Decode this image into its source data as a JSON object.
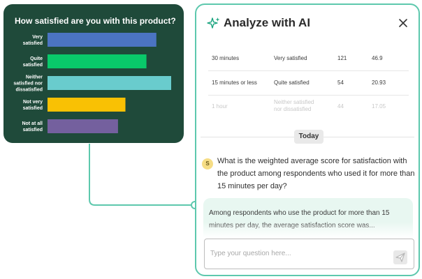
{
  "chart_card": {
    "background": "#1f4a3a",
    "title": "How satisfied are you with this product?"
  },
  "chart_data": {
    "type": "bar",
    "orientation": "horizontal",
    "title": "How satisfied are you with this product?",
    "categories": [
      "Very satisfied",
      "Quite satisfied",
      "Neither satisfied nor dissatisfied",
      "Not very satisfied",
      "Not at all satisfied"
    ],
    "category_lines": [
      [
        "Very",
        "satisfied"
      ],
      [
        "Quite",
        "satisfied"
      ],
      [
        "Neither",
        "satisfied nor",
        "dissatisfied"
      ],
      [
        "Not very",
        "satisfied"
      ],
      [
        "Not at all",
        "satisfied"
      ]
    ],
    "values": [
      88,
      80,
      100,
      63,
      57
    ],
    "colors": [
      "#4b74c2",
      "#09c96a",
      "#69cccd",
      "#f9c104",
      "#74609e"
    ],
    "xlim": [
      0,
      100
    ],
    "grid": false,
    "legend": "none"
  },
  "ai_panel": {
    "title": "Analyze with AI",
    "border_color": "#5dc8ad",
    "close_icon": "close-icon",
    "sparkle_icon": "sparkle-icon",
    "table_rows": [
      {
        "duration": "30 minutes",
        "satisfaction": "Very satisfied",
        "count": "121",
        "percent": "46.9"
      },
      {
        "duration": "15 minutes or less",
        "satisfaction": "Quite satisfied",
        "count": "54",
        "percent": "20.93"
      },
      {
        "duration": "1 hour",
        "satisfaction_line1": "Neither satisfied",
        "satisfaction_line2": "nor dissatisfied",
        "count": "44",
        "percent": "17.05"
      }
    ],
    "date_divider": "Today",
    "user_avatar": "S",
    "user_message": "What is the weighted average score for satisfaction with the product among respondents who used it for more than 15 minutes per day?",
    "ai_message": "Among respondents who use the product for more than 15 minutes per day, the average satisfaction score was...",
    "ai_bubble_color": "#e8f7f1",
    "input_placeholder": "Type your question here...",
    "send_icon": "send-icon"
  }
}
